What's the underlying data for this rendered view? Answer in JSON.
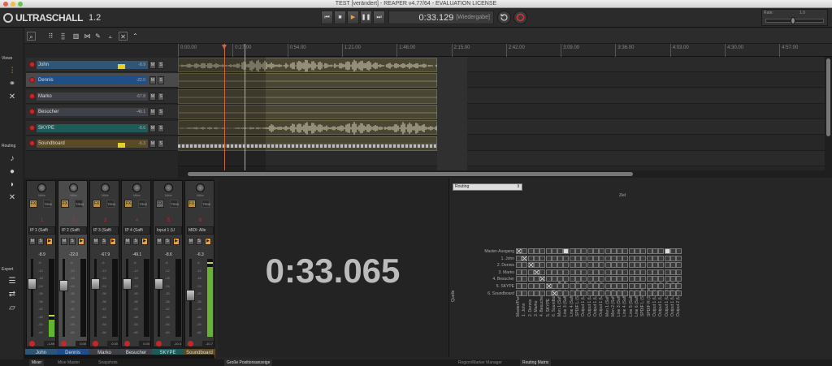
{
  "window": {
    "title": "TEST [verändert] - REAPER v4.77/64 - EVALUATION LICENSE"
  },
  "app": {
    "logo_text": "ULTRASCHALL",
    "version": "1.2"
  },
  "transport": {
    "time": "0:33.129",
    "state": "[Wiedergabe]"
  },
  "rate": {
    "label": "Rate:",
    "value": "1.0"
  },
  "sidebar": {
    "views_label": "Views",
    "routing_label": "Routing",
    "export_label": "Export"
  },
  "ruler": {
    "ticks": [
      "0:00.00",
      "0:27.00",
      "0:54.00",
      "1:21.00",
      "1:48.00",
      "2:15.00",
      "2:42.00",
      "3:09.00",
      "3:36.00",
      "4:03.00",
      "4:30.00",
      "4:57.00"
    ]
  },
  "tracks": [
    {
      "name": "John",
      "volume": "-8.9",
      "color": "#2f5577",
      "meter_color": "#e8d020"
    },
    {
      "name": "Dennis",
      "volume": "-22.0",
      "color": "#1f4f86"
    },
    {
      "name": "Marko",
      "volume": "-67.8",
      "color": "#3d3f44"
    },
    {
      "name": "Besucher",
      "volume": "-49.1",
      "color": "#3e4148"
    },
    {
      "name": "SKYPE",
      "volume": "-8.6",
      "color": "#1e5b5b"
    },
    {
      "name": "Soundboard",
      "volume": "-6.3",
      "color": "#5a4a25",
      "meter_color": "#e8d020"
    }
  ],
  "track_buttons": {
    "mute": "M",
    "solo": "S"
  },
  "mixer": {
    "pan_label": "Mitte",
    "fx_label": "FX",
    "trim_label": "TRIM",
    "scale": [
      "-6",
      "-12",
      "-18",
      "-24",
      "-30",
      "-36",
      "-42",
      "-48",
      "-54",
      "-60"
    ],
    "strips": [
      {
        "number": "1",
        "input": "IP 1 (Saffi",
        "db": "-8.9",
        "peak": "-1.89",
        "name": "John",
        "name_color": "#2f5577",
        "meter_level": 0.22
      },
      {
        "number": "2",
        "input": "IP 2 (Saffi",
        "db": "-22.0",
        "peak": "0.00",
        "name": "Dennis",
        "name_color": "#1f4f86",
        "meter_level": 0
      },
      {
        "number": "3",
        "input": "IP 3 (Saffi",
        "db": "-67.9",
        "peak": "0.00",
        "name": "Marko",
        "name_color": "#3d3f44",
        "meter_level": 0
      },
      {
        "number": "4",
        "input": "IP 4 (Saffi",
        "db": "-49.1",
        "peak": "0.00",
        "name": "Besucher",
        "name_color": "#3e4148",
        "meter_level": 0
      },
      {
        "number": "5",
        "input": "Input 1 (U",
        "db": "-8.6",
        "peak": "-10.4",
        "name": "SKYPE",
        "name_color": "#1e5b5b",
        "meter_level": 0
      },
      {
        "number": "6",
        "input": "MIDI: Alle",
        "db": "-6.3",
        "peak": "-10.7",
        "name": "Soundboard",
        "name_color": "#5a4a25",
        "meter_level": 0.9
      }
    ]
  },
  "clock": {
    "time": "0:33.065"
  },
  "routing": {
    "select_value": "Routing",
    "target_label": "Ziel",
    "source_label": "Quelle",
    "destinations": [
      "Master/Parent",
      "1. John",
      "2. Dennis",
      "3. Marko",
      "4. Besucher",
      "5. SKYPE",
      "6. Soundboard",
      "Mon 1 (Saffire) (Ste",
      "Line 3 (Saffire) (Ste",
      "Line 4 (Saffire) (S",
      "SPDIF L (Saffire) (S",
      "Output 1 (USH Em",
      "Output 1 (USH Sky",
      "Output 1 (USH Aux",
      "Output 1 (USH Sky",
      "Mon 1 (Saffire)",
      "Mon 2 (Saffire)",
      "Line 3 (Saffire)",
      "Line 4 (Saffire)",
      "Line 5 (Saffire)",
      "Line 6 (Saffire)",
      "SPDIF L (Saffire)",
      "SPDIF R (Saffire)",
      "Output 1 (USH Em",
      "Output 1 (USH Sky",
      "Output 1 (USH Aux",
      "Output 1 (USH Sky",
      "Output 2 (USH Aux"
    ],
    "sources": [
      "Master-Ausgang",
      "1. John",
      "2. Dennis",
      "3. Marko",
      "4. Besucher",
      "5. SKYPE",
      "6. Soundboard"
    ]
  },
  "bottom_tabs": {
    "mixer": "Mixer",
    "mixer_master": "Mixe Master",
    "snapshots": "Snapshots",
    "position": "Große Positionsanzeige",
    "region": "Region/Marker Manager",
    "routing": "Routing Matrix"
  }
}
